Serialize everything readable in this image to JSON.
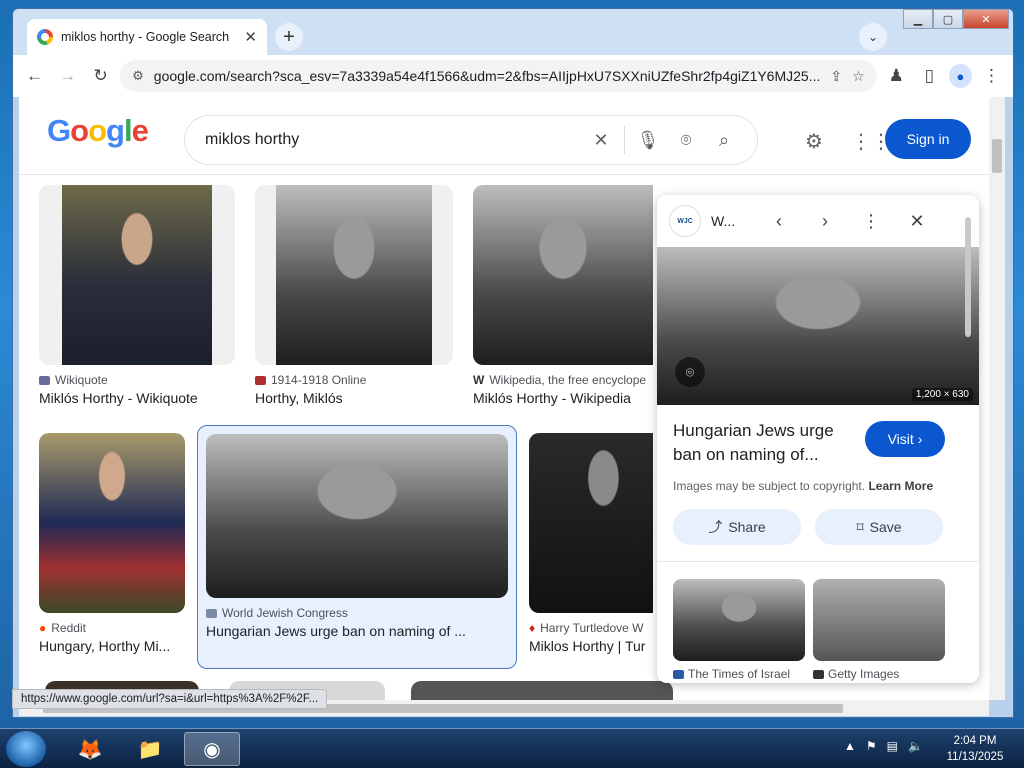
{
  "browser": {
    "tab_title": "miklos horthy - Google Search",
    "url": "google.com/search?sca_esv=7a3339a54e4f1566&udm=2&fbs=AIIjpHxU7SXXniUZfeShr2fp4giZ1Y6MJ25..."
  },
  "search": {
    "query": "miklos horthy",
    "signin_label": "Sign in"
  },
  "logo": [
    "G",
    "o",
    "o",
    "g",
    "l",
    "e"
  ],
  "results": [
    {
      "source": "Wikiquote",
      "title": "Miklós Horthy - Wikiquote"
    },
    {
      "source": "1914-1918 Online",
      "title": "Horthy, Miklós"
    },
    {
      "source": "Wikipedia, the free encyclope",
      "title": "Miklós Horthy - Wikipedia"
    },
    {
      "source": "Reddit",
      "title": "Hungary, Horthy Mi..."
    },
    {
      "source": "World Jewish Congress",
      "title": "Hungarian Jews urge ban on naming of ..."
    },
    {
      "source": "Harry Turtledove W",
      "title": "Miklos Horthy | Tur"
    }
  ],
  "panel": {
    "site_short": "W...",
    "logo_text": "WJC",
    "dimensions": "1,200 × 630",
    "title": "Hungarian Jews urge ban on naming of...",
    "visit_label": "Visit",
    "copyright": "Images may be subject to copyright.",
    "learn_more": "Learn More",
    "share_label": "Share",
    "save_label": "Save",
    "related": [
      {
        "source": "The Times of Israel"
      },
      {
        "source": "Getty Images"
      }
    ]
  },
  "status_url": "https://www.google.com/url?sa=i&url=https%3A%2F%2F...",
  "taskbar": {
    "time": "2:04 PM",
    "date": "11/13/2025"
  },
  "colors": {
    "accent": "#0b57d0",
    "selection_border": "#4a78c2",
    "logo": [
      "#4285f4",
      "#ea4335",
      "#fbbc05",
      "#4285f4",
      "#34a853",
      "#ea4335"
    ]
  }
}
